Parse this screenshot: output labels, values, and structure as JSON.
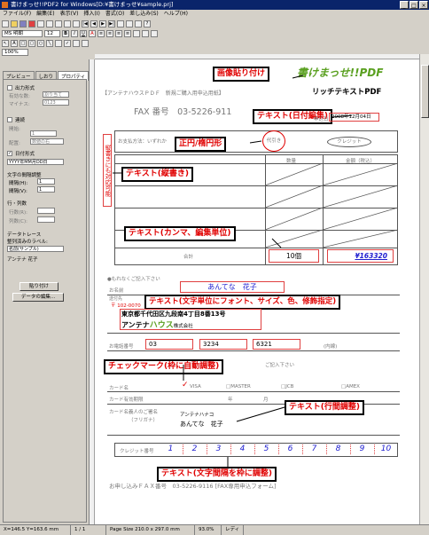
{
  "window": {
    "title": "書けまっせ!!PDF2 for Windows[D:¥書けまっせ¥sample.prj]"
  },
  "menu": [
    "ファイル(F)",
    "編集(E)",
    "表示(V)",
    "挿入(I)",
    "書式(O)",
    "差し込み(S)",
    "ヘルプ(H)"
  ],
  "toolbar": {
    "font": "MS 明朝",
    "size": "12",
    "zoom": "100%"
  },
  "panel": {
    "tabs": [
      "プレビュー",
      "しおり",
      "プロパティ"
    ],
    "output_fixed": "出力形式",
    "size_label": "有効な数:",
    "size_val": "割り当て",
    "mode_label": "マイナス:",
    "mode_val": "0123",
    "serial": "連続",
    "start_label": "開始:",
    "start_val": "1",
    "place_label": "配置:",
    "place_val": "数値の右",
    "date_format": "日付形式",
    "date_val": "YYYY年MM月DD日",
    "spacing_label": "文字の間隔調整",
    "h_label": "間隔(H):",
    "h_val": "1",
    "v_label": "間隔(V):",
    "v_val": "1",
    "line_label": "行・列数",
    "row_label": "行数(R):",
    "col_label": "列数(C):",
    "merge_label": "データトレース",
    "merge_sub": "整列済みのラベル:",
    "merge_val": "名前(サンプル)",
    "merge_name": "アンテナ 花子",
    "paste_btn": "貼り付け",
    "data_btn": "データの編集..."
  },
  "document": {
    "logo_text": "書けまっせ!!PDF",
    "rich_text": "リッチテキストPDF",
    "header": "【アンテナハウスＰＤＦ　新規ご購入用申込用紙】",
    "fax": "FAX 番号　03-5226-911",
    "date_label": "申込日",
    "date_value": "2008年12月04日",
    "payment_label": "お支払方法：いずれか",
    "seal": "代引き",
    "credit": "クレジット",
    "col_qty": "数量",
    "col_amount": "金額（税込）",
    "total_label": "合計",
    "total_qty": "10個",
    "total_amount": "¥163320",
    "note": "●もれなくご記入下さい",
    "name_label": "お名前",
    "name_value": "あんてな　花子",
    "send_label": "送付先",
    "postal": "〒 102-0070",
    "address": "東京都千代田区九段南4丁目8番13号",
    "company_a": "アンテナ",
    "company_b": "ハウス",
    "company_c": "株式会社",
    "phone_label": "お電話番号",
    "phone1": "03",
    "phone2": "3234",
    "phone3": "6321",
    "ext_label": "(内線)",
    "card_label": "カード名",
    "card_opts": [
      "VISA",
      "MASTER",
      "JCB",
      "AMEX"
    ],
    "expiry_label": "カード有効期限",
    "year": "年",
    "month": "月",
    "holder_label": "カード名義人のご署名",
    "holder_sub": "（フリガナ）",
    "holder_kana": "アンテナハナコ",
    "holder_name": "あんてな　花子",
    "card_no_label": "クレジット番号",
    "card_digits": [
      "1",
      "2",
      "3",
      "4",
      "5",
      "6",
      "7",
      "8",
      "9",
      "10"
    ],
    "footer": "お申し込みＦＡＸ番号　03-5226-9116 [FAX専用申込フォーム]",
    "fill_note": "ご記入下さい",
    "vertical_note": "縦書きにも対応可能"
  },
  "callouts": {
    "image_paste": "画像貼り付け",
    "date_edit": "テキスト(日付編集)",
    "circle": "正円/楕円形",
    "vertical": "テキスト(縦書き)",
    "comma": "テキスト(カンマ、編集単位)",
    "font_spec": "テキスト(文字単位にフォント、サイズ、色、修飾指定)",
    "checkmark": "チェックマーク(枠に自動調整)",
    "line_spacing": "テキスト(行間調整)",
    "char_spacing": "テキスト(文字間隔を枠に調整)"
  },
  "status": {
    "coords": "X=146.5 Y=163.6 mm",
    "page": "1 / 1",
    "size": "Page Size 210.0 x 297.0 mm",
    "zoom": "93.0%",
    "ready": "レディ"
  },
  "colors": {
    "accent": "#e00000",
    "title_bar": "#0a246a",
    "logo_green": "#5aa020",
    "blue_text": "#2020d0"
  }
}
